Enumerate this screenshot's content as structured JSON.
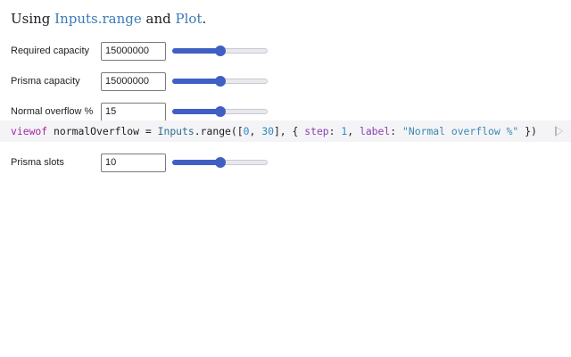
{
  "intro": {
    "prefix": "Using ",
    "link1": "Inputs.range",
    "middle": " and ",
    "link2": "Plot",
    "suffix": "."
  },
  "inputs": [
    {
      "label": "Required capacity",
      "value": "15000000",
      "fraction": 0.5
    },
    {
      "label": "Prisma capacity",
      "value": "15000000",
      "fraction": 0.5
    },
    {
      "label": "Normal overflow %",
      "value": "15",
      "fraction": 0.5
    },
    {
      "label": "Prisma slots",
      "value": "10",
      "fraction": 0.5
    }
  ],
  "code": {
    "t0": "viewof",
    "t1": " normalOverflow = ",
    "t2": "Inputs",
    "t3": ".range([",
    "t4": "0",
    "t5": ", ",
    "t6": "30",
    "t7": "], { ",
    "t8": "step",
    "t9": ": ",
    "t10": "1",
    "t11": ", ",
    "t12": "label",
    "t13": ": ",
    "t14": "\"Normal overflow %\"",
    "t15": " })"
  },
  "colors": {
    "accent": "#3f5fc4",
    "link": "#3b7ab7",
    "code_bg": "#f4f4f6"
  },
  "icons": {
    "run": "play-icon"
  }
}
